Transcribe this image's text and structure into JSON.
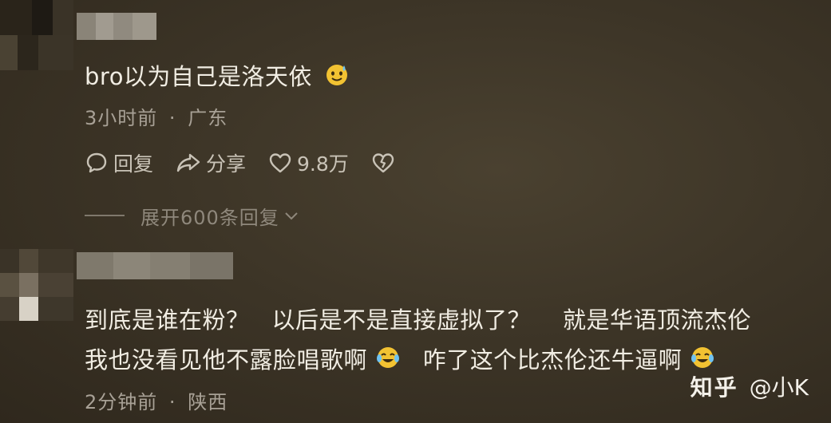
{
  "comments": [
    {
      "text": "bro以为自己是洛天依",
      "emoji": "sweat-smile-emoji",
      "time": "3小时前",
      "separator": "·",
      "location": "广东",
      "actions": {
        "reply_label": "回复",
        "share_label": "分享",
        "like_count": "9.8万"
      },
      "expand_label": "展开600条回复"
    },
    {
      "line1_part1": "到底是谁在粉？",
      "line1_part2": "以后是不是直接虚拟了？",
      "line1_part3": "就是华语顶流杰伦",
      "line2_part1": "我也没看见他不露脸唱歌啊",
      "line2_part2": "咋了这个比杰伦还牛逼啊",
      "emoji": "tears-of-joy-emoji",
      "time": "2分钟前",
      "separator": "·",
      "location": "陕西"
    }
  ],
  "watermark": {
    "brand": "知乎",
    "user": "@小K"
  }
}
